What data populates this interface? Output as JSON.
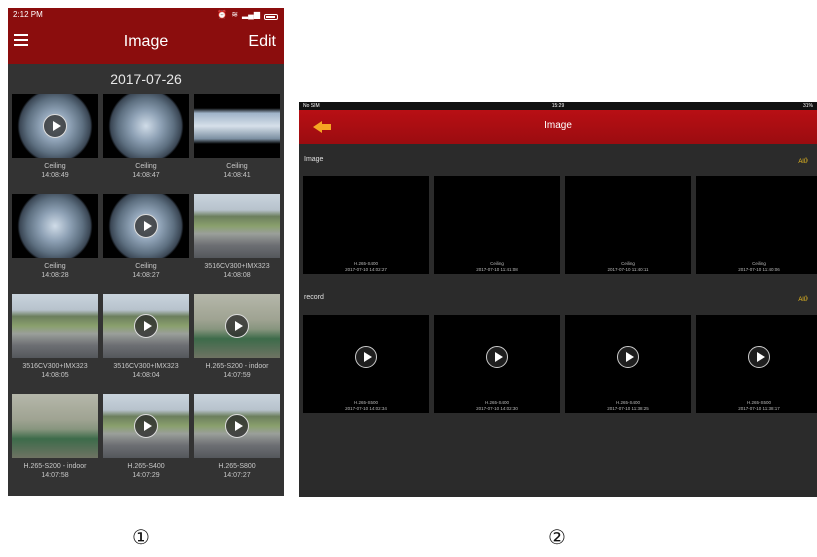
{
  "phone": {
    "status": {
      "time": "2:12 PM"
    },
    "title": "Image",
    "edit_label": "Edit",
    "date_header": "2017-07-26",
    "items": [
      {
        "name": "Ceiling",
        "time": "14:08:49",
        "video": true,
        "style": "fish"
      },
      {
        "name": "Ceiling",
        "time": "14:08:47",
        "video": false,
        "style": "fish"
      },
      {
        "name": "Ceiling",
        "time": "14:08:41",
        "video": false,
        "style": "fishbar"
      },
      {
        "name": "Ceiling",
        "time": "14:08:28",
        "video": false,
        "style": "fish"
      },
      {
        "name": "Ceiling",
        "time": "14:08:27",
        "video": true,
        "style": "fish"
      },
      {
        "name": "3516CV300+IMX323",
        "time": "14:08:08",
        "video": false,
        "style": "street"
      },
      {
        "name": "3516CV300+IMX323",
        "time": "14:08:05",
        "video": false,
        "style": "street"
      },
      {
        "name": "3516CV300+IMX323",
        "time": "14:08:04",
        "video": true,
        "style": "street"
      },
      {
        "name": "H.265-S200 - indoor",
        "time": "14:07:59",
        "video": true,
        "style": "indoor"
      },
      {
        "name": "H.265-S200 - indoor",
        "time": "14:07:58",
        "video": false,
        "style": "indoor"
      },
      {
        "name": "H.265-S400",
        "time": "14:07:29",
        "video": true,
        "style": "street"
      },
      {
        "name": "H.265-S800",
        "time": "14:07:27",
        "video": true,
        "style": "street"
      }
    ]
  },
  "tablet": {
    "status": {
      "carrier": "No SIM",
      "time": "15:29",
      "battery": "31%"
    },
    "title": "Image",
    "image_section": {
      "label": "Image",
      "all_label": "All》"
    },
    "record_section": {
      "label": "record",
      "all_label": "All》"
    },
    "images": [
      {
        "name": "H.265-S400",
        "datetime": "2017-07-10 14:02:27",
        "style": "street"
      },
      {
        "name": "Ceiling",
        "datetime": "2017-07-10 11:41:08",
        "style": "fish"
      },
      {
        "name": "Ceiling",
        "datetime": "2017-07-10 11:40:11",
        "style": "fish"
      },
      {
        "name": "Ceiling",
        "datetime": "2017-07-10 11:40:06",
        "style": "fish"
      }
    ],
    "records": [
      {
        "name": "H.265-S500",
        "datetime": "2017-07-10 14:02:34",
        "style": "street"
      },
      {
        "name": "H.265-S400",
        "datetime": "2017-07-10 14:02:30",
        "style": "street"
      },
      {
        "name": "H.265-S400",
        "datetime": "2017-07-10 11:38:25",
        "style": "street"
      },
      {
        "name": "H.265-S500",
        "datetime": "2017-07-10 11:38:17",
        "style": "street"
      }
    ]
  },
  "markers": {
    "first": "①",
    "second": "②"
  }
}
